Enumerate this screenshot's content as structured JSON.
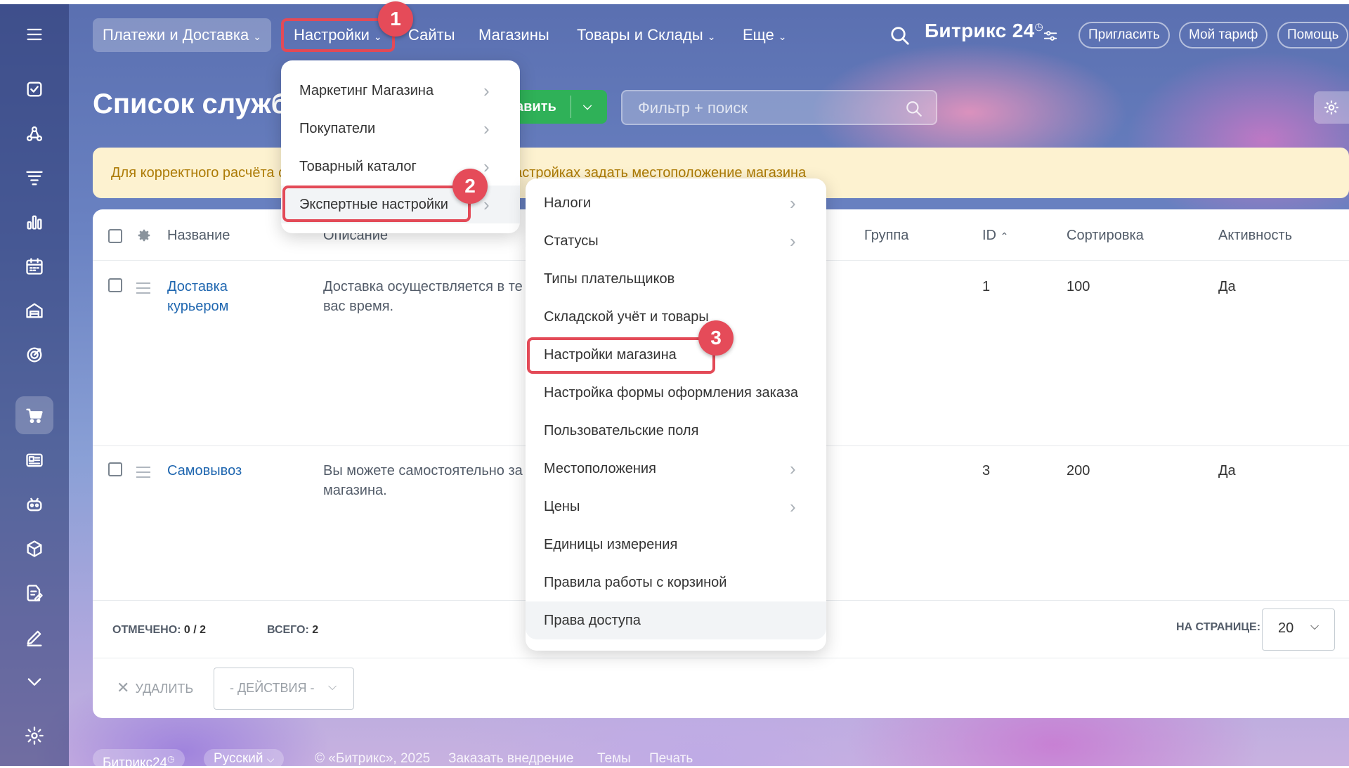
{
  "topnav": {
    "items": [
      {
        "label": "Платежи и Доставка",
        "chevron": "⌄"
      },
      {
        "label": "Настройки",
        "chevron": "⌄"
      },
      {
        "label": "Сайты"
      },
      {
        "label": "Магазины"
      },
      {
        "label": "Товары и Склады",
        "chevron": "⌄"
      },
      {
        "label": "Еще",
        "chevron": "⌄"
      }
    ],
    "logo": "Битрикс 24",
    "logo_mark": "◷",
    "invite": "Пригласить",
    "tariff": "Мой тариф",
    "help": "Помощь"
  },
  "markers": [
    "1",
    "2",
    "3"
  ],
  "page": {
    "title": "Список служб д",
    "add_button": "авить",
    "filter_placeholder": "Фильтр + поиск",
    "warning": "Для корректного расчёта стоимости доставки необходимо в настройках задать местоположение магазина"
  },
  "table": {
    "headers": {
      "name": "Название",
      "description": "Описание",
      "group": "Группа",
      "id": "ID",
      "sort": "Сортировка",
      "active": "Активность"
    },
    "rows": [
      {
        "name": "Доставка курьером",
        "description": "Доставка осуществляется в те удобное для вас время.",
        "id": "1",
        "sort": "100",
        "active": "Да"
      },
      {
        "name": "Самовывоз",
        "description": "Вы можете самостоятельно за нашего магазина.",
        "id": "3",
        "sort": "200",
        "active": "Да"
      }
    ],
    "footer": {
      "checked_label": "ОТМЕЧЕНО:",
      "checked_value": "0 / 2",
      "total_label": "ВСЕГО:",
      "total_value": "2",
      "per_page_label": "НА СТРАНИЦЕ:",
      "per_page_value": "20",
      "delete": "УДАЛИТЬ",
      "actions": "- ДЕЙСТВИЯ -"
    }
  },
  "settings_menu": {
    "items": [
      {
        "label": "Маркетинг Магазина",
        "submenu": true
      },
      {
        "label": "Покупатели",
        "submenu": true
      },
      {
        "label": "Товарный каталог",
        "submenu": true
      },
      {
        "label": "Экспертные настройки",
        "submenu": true
      }
    ]
  },
  "expert_menu": {
    "items": [
      {
        "label": "Налоги",
        "submenu": true
      },
      {
        "label": "Статусы",
        "submenu": true
      },
      {
        "label": "Типы плательщиков",
        "submenu": false
      },
      {
        "label": "Складской учёт и товары",
        "submenu": false
      },
      {
        "label": "Настройки магазина",
        "submenu": false
      },
      {
        "label": "Настройка формы оформления заказа",
        "submenu": false
      },
      {
        "label": "Пользовательские поля",
        "submenu": false
      },
      {
        "label": "Местоположения",
        "submenu": true
      },
      {
        "label": "Цены",
        "submenu": true
      },
      {
        "label": "Единицы измерения",
        "submenu": false
      },
      {
        "label": "Правила работы с корзиной",
        "submenu": false
      },
      {
        "label": "Права доступа",
        "submenu": false
      }
    ]
  },
  "bottom_footer": {
    "brand": "Битрикс24",
    "lang": "Русский",
    "copyright": "© «Битрикс», 2025",
    "order": "Заказать внедрение",
    "themes": "Темы",
    "print": "Печать"
  },
  "sidebar_icons": [
    "menu-icon",
    "tasks-icon",
    "crm-icon",
    "funnel-icon",
    "analytics-icon",
    "calendar-icon",
    "warehouse-icon",
    "target-icon",
    "cart-icon",
    "contacts-card-icon",
    "robot-icon",
    "box-icon",
    "document-sign-icon",
    "pen-icon",
    "more-chevron-icon",
    "settings-icon"
  ],
  "colors": {
    "accent_red": "#e34a57",
    "green_button": "#2fb158",
    "link_blue": "#2067b0",
    "warning_bg": "#fdf2d0",
    "warning_text": "#ad7b06"
  }
}
